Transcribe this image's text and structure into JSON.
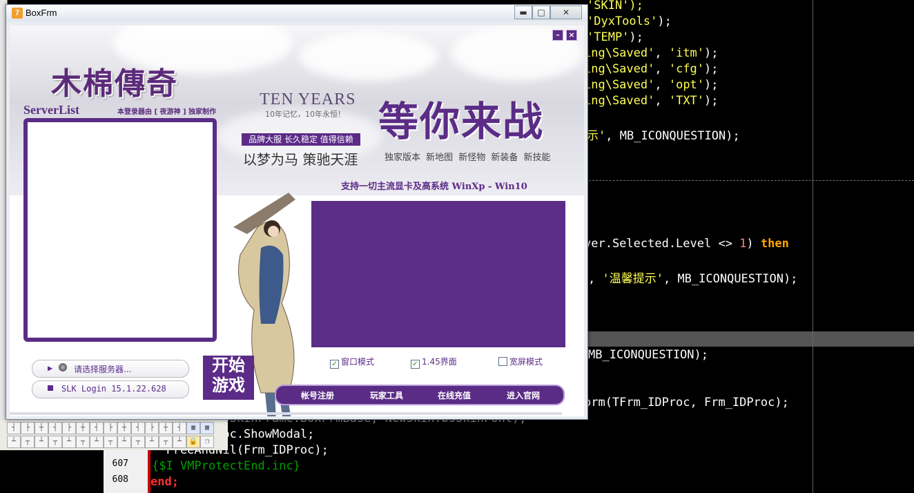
{
  "window": {
    "title": "BoxFrm",
    "minimize_glyph": "▬",
    "maximize_glyph": "□",
    "close_glyph": "✕",
    "app_icon": "7"
  },
  "launcher": {
    "mini_glyph": "–",
    "close_glyph": "×",
    "logo": "木棉傳奇",
    "serverlist_title": "ServerList",
    "credit": "本登录器由 [ 夜游神 ] 独家制作",
    "ten_years": "TEN YEARS",
    "ten_years_sub": "10年记忆，10年永恒！",
    "slogan_badge": "品牌大服  长久稳定  值得信赖",
    "slogan2": "以梦为马 策驰天涯",
    "big_title": "等你来战",
    "features": "独家版本 新地图 新怪物 新装备 新技能",
    "support": "支持一切主流显卡及高系统 WinXp - Win10",
    "server_select_label": "请选择服务器...",
    "version_label": "SLK Login 15.1.22.628",
    "start_button": "开始游戏",
    "checkboxes": [
      {
        "label": "窗口模式",
        "checked": true
      },
      {
        "label": "1.45界面",
        "checked": true
      },
      {
        "label": "宽屏模式",
        "checked": false
      }
    ],
    "nav": [
      "帐号注册",
      "玩家工具",
      "在线充值",
      "进入官网"
    ],
    "accent_color": "#5c2b88"
  },
  "editor": {
    "lines": [
      {
        "pre": "'SKIN');",
        "tokens": "str"
      },
      {
        "text": "'DyxTools');"
      },
      {
        "text": "'TEMP');"
      },
      {
        "text": "ing\\Saved', 'itm');"
      },
      {
        "text": "ing\\Saved', 'cfg');"
      },
      {
        "text": "ing\\Saved', 'opt');"
      },
      {
        "text": "ing\\Saved', 'TXT');"
      },
      {
        "text": "示', MB_ICONQUESTION);"
      },
      {
        "text": "ver.Selected.Level <> 1) then"
      },
      {
        "text": ", '温馨提示', MB_ICONQUESTION);"
      },
      {
        "text": "MB_ICONQUESTION);"
      },
      {
        "text": "orm(TFrm_IDProc, Frm_IDProc);"
      },
      {
        "text": "oc.ShowModal;"
      },
      {
        "text": "FreeAndNil(Frm_IDProc);"
      },
      {
        "text": "{$I VMProtectEnd.inc}"
      },
      {
        "text": "end;"
      }
    ],
    "line_numbers": [
      "607",
      "608"
    ]
  }
}
